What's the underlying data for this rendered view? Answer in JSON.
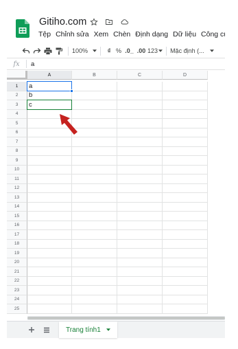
{
  "app": {
    "doc_title": "Gitiho.com",
    "menus": [
      "Tệp",
      "Chỉnh sửa",
      "Xem",
      "Chèn",
      "Định dạng",
      "Dữ liệu",
      "Công cụ"
    ],
    "icons": [
      "star-icon",
      "move-folder-icon",
      "cloud-status-icon"
    ],
    "colors": {
      "sheets_green": "#188038",
      "selection_blue": "#1a73e8",
      "annotation_red": "#c5221f"
    }
  },
  "toolbar": {
    "zoom": "100%",
    "currency": "₫",
    "percent": "%",
    "decrease_decimals": ".0_",
    "increase_decimals": ".00",
    "more_formats": "123",
    "font": "Mặc định (..."
  },
  "formula_bar": {
    "fx_label": "fx",
    "value": "a"
  },
  "grid": {
    "columns": [
      "A",
      "B",
      "C",
      "D"
    ],
    "rows": [
      "1",
      "2",
      "3",
      "4",
      "5",
      "6",
      "7",
      "8",
      "9",
      "10",
      "11",
      "12",
      "13",
      "14",
      "15",
      "16",
      "17",
      "18",
      "19",
      "20",
      "21",
      "22",
      "23",
      "24",
      "25"
    ],
    "cells": {
      "A1": "a",
      "A2": "b",
      "A3": "c"
    },
    "selected_cell": "A1",
    "highlighted_cell": "A3"
  },
  "sheets": {
    "tabs": [
      "Trang tính1"
    ],
    "active": "Trang tính1"
  }
}
